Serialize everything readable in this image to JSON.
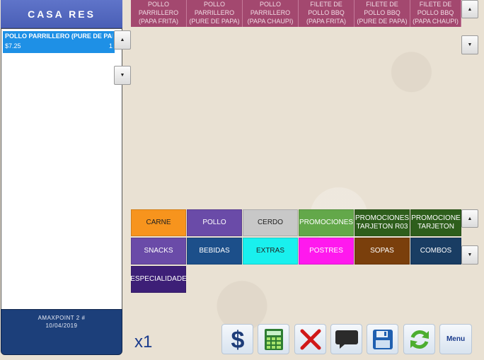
{
  "app": {
    "title": "CASA RES"
  },
  "order": {
    "items": [
      {
        "name": "POLLO PARRILLERO (PURE DE PAPA)",
        "price": "$7.25",
        "qty": "1"
      }
    ]
  },
  "footer": {
    "terminal": "AMAXPOINT 2 #",
    "date": "10/04/2019"
  },
  "products": [
    {
      "label": "POLLO PARRILLERO (PAPA FRITA)"
    },
    {
      "label": "POLLO PARRILLERO (PURE DE PAPA)"
    },
    {
      "label": "POLLO PARRILLERO (PAPA CHAUPI)"
    },
    {
      "label": "FILETE DE POLLO BBQ (PAPA FRITA)"
    },
    {
      "label": "FILETE DE POLLO BBQ (PURE DE PAPA)"
    },
    {
      "label": "FILETE DE POLLO BBQ (PAPA CHAUPI)"
    }
  ],
  "categories": [
    {
      "label": "CARNE",
      "bg": "#f7941d",
      "fg": "#222222"
    },
    {
      "label": "POLLO",
      "bg": "#6a4ba8",
      "fg": "#ffffff"
    },
    {
      "label": "CERDO",
      "bg": "#c8c8c8",
      "fg": "#222222"
    },
    {
      "label": "PROMOCIONES",
      "bg": "#63a84a",
      "fg": "#ffffff"
    },
    {
      "label": "PROMOCIONES TARJETON R03",
      "bg": "#2e5e1c",
      "fg": "#ffffff"
    },
    {
      "label": "PROMOCIONE TARJETON",
      "bg": "#2e5e1c",
      "fg": "#ffffff"
    },
    {
      "label": "SNACKS",
      "bg": "#6a4ba8",
      "fg": "#ffffff"
    },
    {
      "label": "BEBIDAS",
      "bg": "#1c4f8a",
      "fg": "#ffffff"
    },
    {
      "label": "EXTRAS",
      "bg": "#19f0ee",
      "fg": "#222222"
    },
    {
      "label": "POSTRES",
      "bg": "#ff19ee",
      "fg": "#ffffff"
    },
    {
      "label": "SOPAS",
      "bg": "#7a3f0c",
      "fg": "#ffffff"
    },
    {
      "label": "COMBOS",
      "bg": "#193d63",
      "fg": "#ffffff"
    },
    {
      "label": "ESPECIALIDADE",
      "bg": "#3d1f77",
      "fg": "#ffffff"
    }
  ],
  "toolbar": {
    "qty": "x1",
    "menu_label": "Menu",
    "icons": [
      "dollar-icon",
      "calculator-icon",
      "close-icon",
      "comment-icon",
      "save-icon",
      "refresh-icon"
    ]
  },
  "colors": {
    "title_bar": "#4f64ba",
    "selected_item": "#1e90e6",
    "product_button": "#a3486f",
    "footer": "#1c3f7a"
  }
}
